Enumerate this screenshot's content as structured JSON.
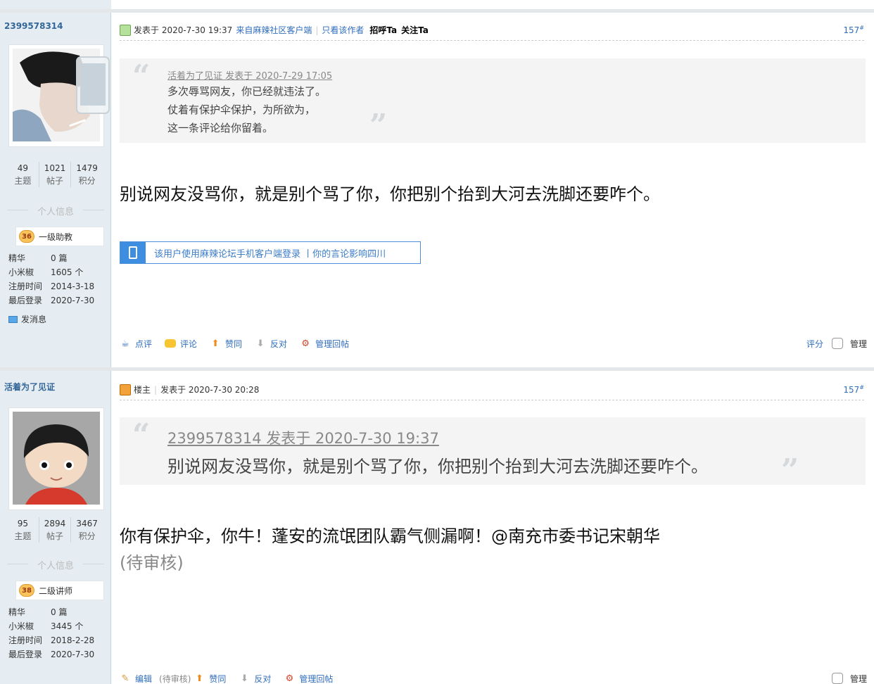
{
  "top_partial_actions": [
    "点评",
    "评论",
    "赞同",
    "反对",
    "管理回帖"
  ],
  "posts": [
    {
      "author": "2399578314",
      "stats": [
        {
          "num": "49",
          "label": "主题"
        },
        {
          "num": "1021",
          "label": "帖子"
        },
        {
          "num": "1479",
          "label": "积分"
        }
      ],
      "info_header": "个人信息",
      "level_num": "36",
      "level_title": "一级助教",
      "profile": [
        {
          "k": "精华",
          "v": "0 篇"
        },
        {
          "k": "小米椒",
          "v": "1605 个"
        },
        {
          "k": "注册时间",
          "v": "2014-3-18"
        },
        {
          "k": "最后登录",
          "v": "2020-7-30"
        }
      ],
      "send_message": "发消息",
      "header": {
        "posted": "发表于 2020-7-30 19:37",
        "client": "来自麻辣社区客户端",
        "only_author": "只看该作者",
        "greet": "招呼Ta",
        "follow": "关注Ta",
        "floor": "157",
        "floor_sup": "#"
      },
      "quote": {
        "attribution": "活着为了见证 发表于 2020-7-29 17:05",
        "lines": [
          "多次辱骂网友，你已经就违法了。",
          "仗着有保护伞保护，为所欲为，",
          "这一条评论给你留着。"
        ]
      },
      "content": "别说网友没骂你，就是别个骂了你，你把别个抬到大河去洗脚还要咋个。",
      "mobile_notice": "该用户使用麻辣论坛手机客户端登录 丨你的言论影响四川",
      "actions": [
        "点评",
        "评论",
        "赞同",
        "反对",
        "管理回帖"
      ],
      "rate": "评分",
      "manage": "管理"
    },
    {
      "author": "活着为了见证",
      "stats": [
        {
          "num": "95",
          "label": "主题"
        },
        {
          "num": "2894",
          "label": "帖子"
        },
        {
          "num": "3467",
          "label": "积分"
        }
      ],
      "info_header": "个人信息",
      "level_num": "38",
      "level_title": "二级讲师",
      "profile": [
        {
          "k": "精华",
          "v": "0 篇"
        },
        {
          "k": "小米椒",
          "v": "3445 个"
        },
        {
          "k": "注册时间",
          "v": "2018-2-28"
        },
        {
          "k": "最后登录",
          "v": "2020-7-30"
        }
      ],
      "header": {
        "op_label": "楼主",
        "posted": "发表于 2020-7-30 20:28",
        "floor": "157",
        "floor_sup": "#"
      },
      "quote": {
        "attribution": "2399578314 发表于 2020-7-30 19:37",
        "lines": [
          "别说网友没骂你，就是别个骂了你，你把别个抬到大河去洗脚还要咋个。"
        ]
      },
      "content": "你有保护伞，你牛！蓬安的流氓团队霸气侧漏啊！@南充市委书记宋朝华",
      "pending": "(待审核)",
      "actions": [
        "编辑",
        "赞同",
        "反对",
        "管理回帖"
      ],
      "pending_small": "(待审核)",
      "manage": "管理"
    }
  ]
}
